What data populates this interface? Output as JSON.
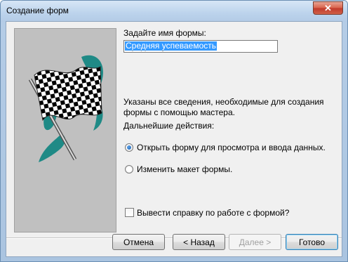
{
  "window": {
    "title": "Создание форм",
    "close_glyph": "✕"
  },
  "form_name": {
    "label": "Задайте имя формы:",
    "value": "Средняя успеваемость"
  },
  "info": {
    "line1": "Указаны все сведения, необходимые для создания",
    "line2": "формы с помощью мастера.",
    "next_actions": "Дальнейшие действия:"
  },
  "options": [
    {
      "label": "Открыть форму для просмотра и ввода данных.",
      "checked": true
    },
    {
      "label": "Изменить макет формы.",
      "checked": false
    }
  ],
  "help_checkbox": {
    "label": "Вывести справку по работе с формой?",
    "checked": false
  },
  "buttons": {
    "cancel": "Отмена",
    "back": "< Назад",
    "next": "Далее >",
    "finish": "Готово"
  },
  "picture_icon": "checkered-flag-icon"
}
